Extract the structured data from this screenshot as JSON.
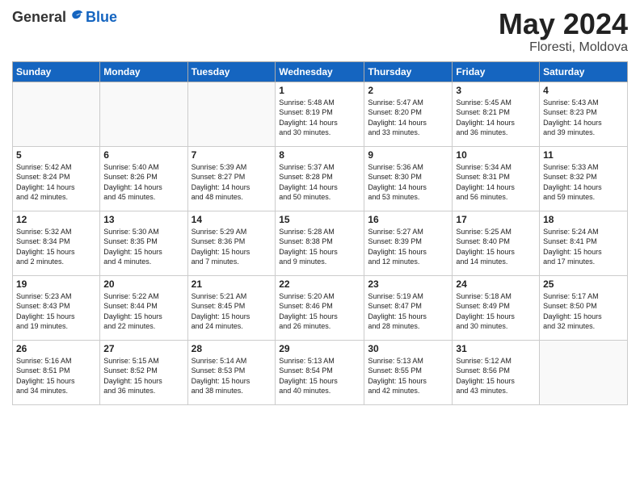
{
  "header": {
    "logo_general": "General",
    "logo_blue": "Blue",
    "title": "May 2024",
    "location": "Floresti, Moldova"
  },
  "weekdays": [
    "Sunday",
    "Monday",
    "Tuesday",
    "Wednesday",
    "Thursday",
    "Friday",
    "Saturday"
  ],
  "weeks": [
    [
      {
        "day": "",
        "info": ""
      },
      {
        "day": "",
        "info": ""
      },
      {
        "day": "",
        "info": ""
      },
      {
        "day": "1",
        "info": "Sunrise: 5:48 AM\nSunset: 8:19 PM\nDaylight: 14 hours\nand 30 minutes."
      },
      {
        "day": "2",
        "info": "Sunrise: 5:47 AM\nSunset: 8:20 PM\nDaylight: 14 hours\nand 33 minutes."
      },
      {
        "day": "3",
        "info": "Sunrise: 5:45 AM\nSunset: 8:21 PM\nDaylight: 14 hours\nand 36 minutes."
      },
      {
        "day": "4",
        "info": "Sunrise: 5:43 AM\nSunset: 8:23 PM\nDaylight: 14 hours\nand 39 minutes."
      }
    ],
    [
      {
        "day": "5",
        "info": "Sunrise: 5:42 AM\nSunset: 8:24 PM\nDaylight: 14 hours\nand 42 minutes."
      },
      {
        "day": "6",
        "info": "Sunrise: 5:40 AM\nSunset: 8:26 PM\nDaylight: 14 hours\nand 45 minutes."
      },
      {
        "day": "7",
        "info": "Sunrise: 5:39 AM\nSunset: 8:27 PM\nDaylight: 14 hours\nand 48 minutes."
      },
      {
        "day": "8",
        "info": "Sunrise: 5:37 AM\nSunset: 8:28 PM\nDaylight: 14 hours\nand 50 minutes."
      },
      {
        "day": "9",
        "info": "Sunrise: 5:36 AM\nSunset: 8:30 PM\nDaylight: 14 hours\nand 53 minutes."
      },
      {
        "day": "10",
        "info": "Sunrise: 5:34 AM\nSunset: 8:31 PM\nDaylight: 14 hours\nand 56 minutes."
      },
      {
        "day": "11",
        "info": "Sunrise: 5:33 AM\nSunset: 8:32 PM\nDaylight: 14 hours\nand 59 minutes."
      }
    ],
    [
      {
        "day": "12",
        "info": "Sunrise: 5:32 AM\nSunset: 8:34 PM\nDaylight: 15 hours\nand 2 minutes."
      },
      {
        "day": "13",
        "info": "Sunrise: 5:30 AM\nSunset: 8:35 PM\nDaylight: 15 hours\nand 4 minutes."
      },
      {
        "day": "14",
        "info": "Sunrise: 5:29 AM\nSunset: 8:36 PM\nDaylight: 15 hours\nand 7 minutes."
      },
      {
        "day": "15",
        "info": "Sunrise: 5:28 AM\nSunset: 8:38 PM\nDaylight: 15 hours\nand 9 minutes."
      },
      {
        "day": "16",
        "info": "Sunrise: 5:27 AM\nSunset: 8:39 PM\nDaylight: 15 hours\nand 12 minutes."
      },
      {
        "day": "17",
        "info": "Sunrise: 5:25 AM\nSunset: 8:40 PM\nDaylight: 15 hours\nand 14 minutes."
      },
      {
        "day": "18",
        "info": "Sunrise: 5:24 AM\nSunset: 8:41 PM\nDaylight: 15 hours\nand 17 minutes."
      }
    ],
    [
      {
        "day": "19",
        "info": "Sunrise: 5:23 AM\nSunset: 8:43 PM\nDaylight: 15 hours\nand 19 minutes."
      },
      {
        "day": "20",
        "info": "Sunrise: 5:22 AM\nSunset: 8:44 PM\nDaylight: 15 hours\nand 22 minutes."
      },
      {
        "day": "21",
        "info": "Sunrise: 5:21 AM\nSunset: 8:45 PM\nDaylight: 15 hours\nand 24 minutes."
      },
      {
        "day": "22",
        "info": "Sunrise: 5:20 AM\nSunset: 8:46 PM\nDaylight: 15 hours\nand 26 minutes."
      },
      {
        "day": "23",
        "info": "Sunrise: 5:19 AM\nSunset: 8:47 PM\nDaylight: 15 hours\nand 28 minutes."
      },
      {
        "day": "24",
        "info": "Sunrise: 5:18 AM\nSunset: 8:49 PM\nDaylight: 15 hours\nand 30 minutes."
      },
      {
        "day": "25",
        "info": "Sunrise: 5:17 AM\nSunset: 8:50 PM\nDaylight: 15 hours\nand 32 minutes."
      }
    ],
    [
      {
        "day": "26",
        "info": "Sunrise: 5:16 AM\nSunset: 8:51 PM\nDaylight: 15 hours\nand 34 minutes."
      },
      {
        "day": "27",
        "info": "Sunrise: 5:15 AM\nSunset: 8:52 PM\nDaylight: 15 hours\nand 36 minutes."
      },
      {
        "day": "28",
        "info": "Sunrise: 5:14 AM\nSunset: 8:53 PM\nDaylight: 15 hours\nand 38 minutes."
      },
      {
        "day": "29",
        "info": "Sunrise: 5:13 AM\nSunset: 8:54 PM\nDaylight: 15 hours\nand 40 minutes."
      },
      {
        "day": "30",
        "info": "Sunrise: 5:13 AM\nSunset: 8:55 PM\nDaylight: 15 hours\nand 42 minutes."
      },
      {
        "day": "31",
        "info": "Sunrise: 5:12 AM\nSunset: 8:56 PM\nDaylight: 15 hours\nand 43 minutes."
      },
      {
        "day": "",
        "info": ""
      }
    ]
  ]
}
